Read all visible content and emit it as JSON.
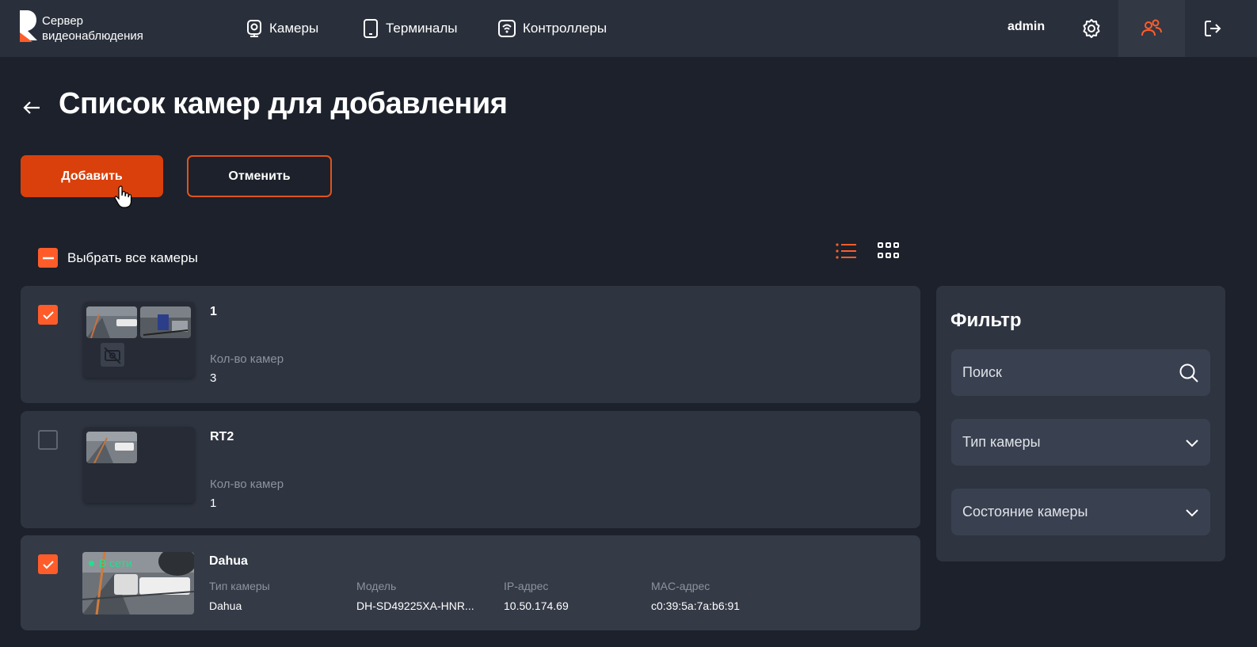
{
  "header": {
    "logo_text_line1": "Сервер",
    "logo_text_line2": "видеонаблюдения",
    "nav": [
      {
        "label": "Камеры",
        "icon": "webcam-icon"
      },
      {
        "label": "Терминалы",
        "icon": "tablet-icon"
      },
      {
        "label": "Контроллеры",
        "icon": "controller-icon"
      }
    ],
    "user": "admin"
  },
  "page": {
    "title": "Список камер для добавления",
    "add_button": "Добавить",
    "cancel_button": "Отменить",
    "select_all_label": "Выбрать все камеры"
  },
  "cards": [
    {
      "title": "1",
      "checked": true,
      "count_label": "Кол-во камер",
      "count_value": "3"
    },
    {
      "title": "RT2",
      "checked": false,
      "count_label": "Кол-во камер",
      "count_value": "1"
    },
    {
      "title": "Dahua",
      "checked": true,
      "status": "В сети",
      "fields": [
        {
          "label": "Тип камеры",
          "value": "Dahua"
        },
        {
          "label": "Модель",
          "value": "DH-SD49225XA-HNR..."
        },
        {
          "label": "IP-адрес",
          "value": "10.50.174.69"
        },
        {
          "label": "MAC-адрес",
          "value": "c0:39:5a:7a:b6:91"
        }
      ]
    }
  ],
  "filter": {
    "title": "Фильтр",
    "search_placeholder": "Поиск",
    "camera_type": "Тип камеры",
    "camera_state": "Состояние камеры"
  },
  "colors": {
    "accent": "#d9400b",
    "accent_light": "#ff5c2a",
    "background": "#1c212b",
    "header": "#2a303b",
    "card": "#2e3440",
    "online": "#1fe08f"
  }
}
